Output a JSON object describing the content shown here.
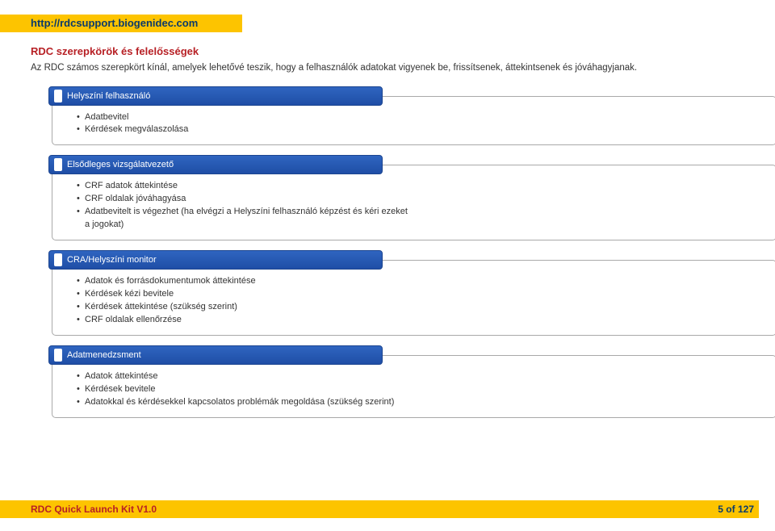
{
  "header": {
    "url": "http://rdcsupport.biogenidec.com"
  },
  "doc": {
    "title": "RDC szerepkörök és felelősségek",
    "intro": "Az RDC számos szerepkört kínál, amelyek lehetővé teszik, hogy a felhasználók adatokat vigyenek be, frissítsenek, áttekintsenek és jóváhagyjanak."
  },
  "sections": [
    {
      "heading": "Helyszíni felhasználó",
      "items": [
        "Adatbevitel",
        "Kérdések megválaszolása"
      ]
    },
    {
      "heading": "Elsődleges vizsgálatvezető",
      "items": [
        "CRF adatok áttekintése",
        "CRF oldalak jóváhagyása",
        "Adatbevitelt is végezhet (ha elvégzi a Helyszíni felhasználó képzést és kéri ezeket",
        "a jogokat)"
      ]
    },
    {
      "heading": "CRA/Helyszíni monitor",
      "items": [
        "Adatok és forrásdokumentumok áttekintése",
        "Kérdések kézi bevitele",
        "Kérdések áttekintése (szükség szerint)",
        "CRF oldalak ellenőrzése"
      ]
    },
    {
      "heading": "Adatmenedzsment",
      "items": [
        "Adatok áttekintése",
        "Kérdések bevitele",
        "Adatokkal és kérdésekkel kapcsolatos problémák megoldása (szükség szerint)"
      ]
    }
  ],
  "footer": {
    "left": "RDC Quick Launch Kit V1.0",
    "right": "5 of 127"
  }
}
